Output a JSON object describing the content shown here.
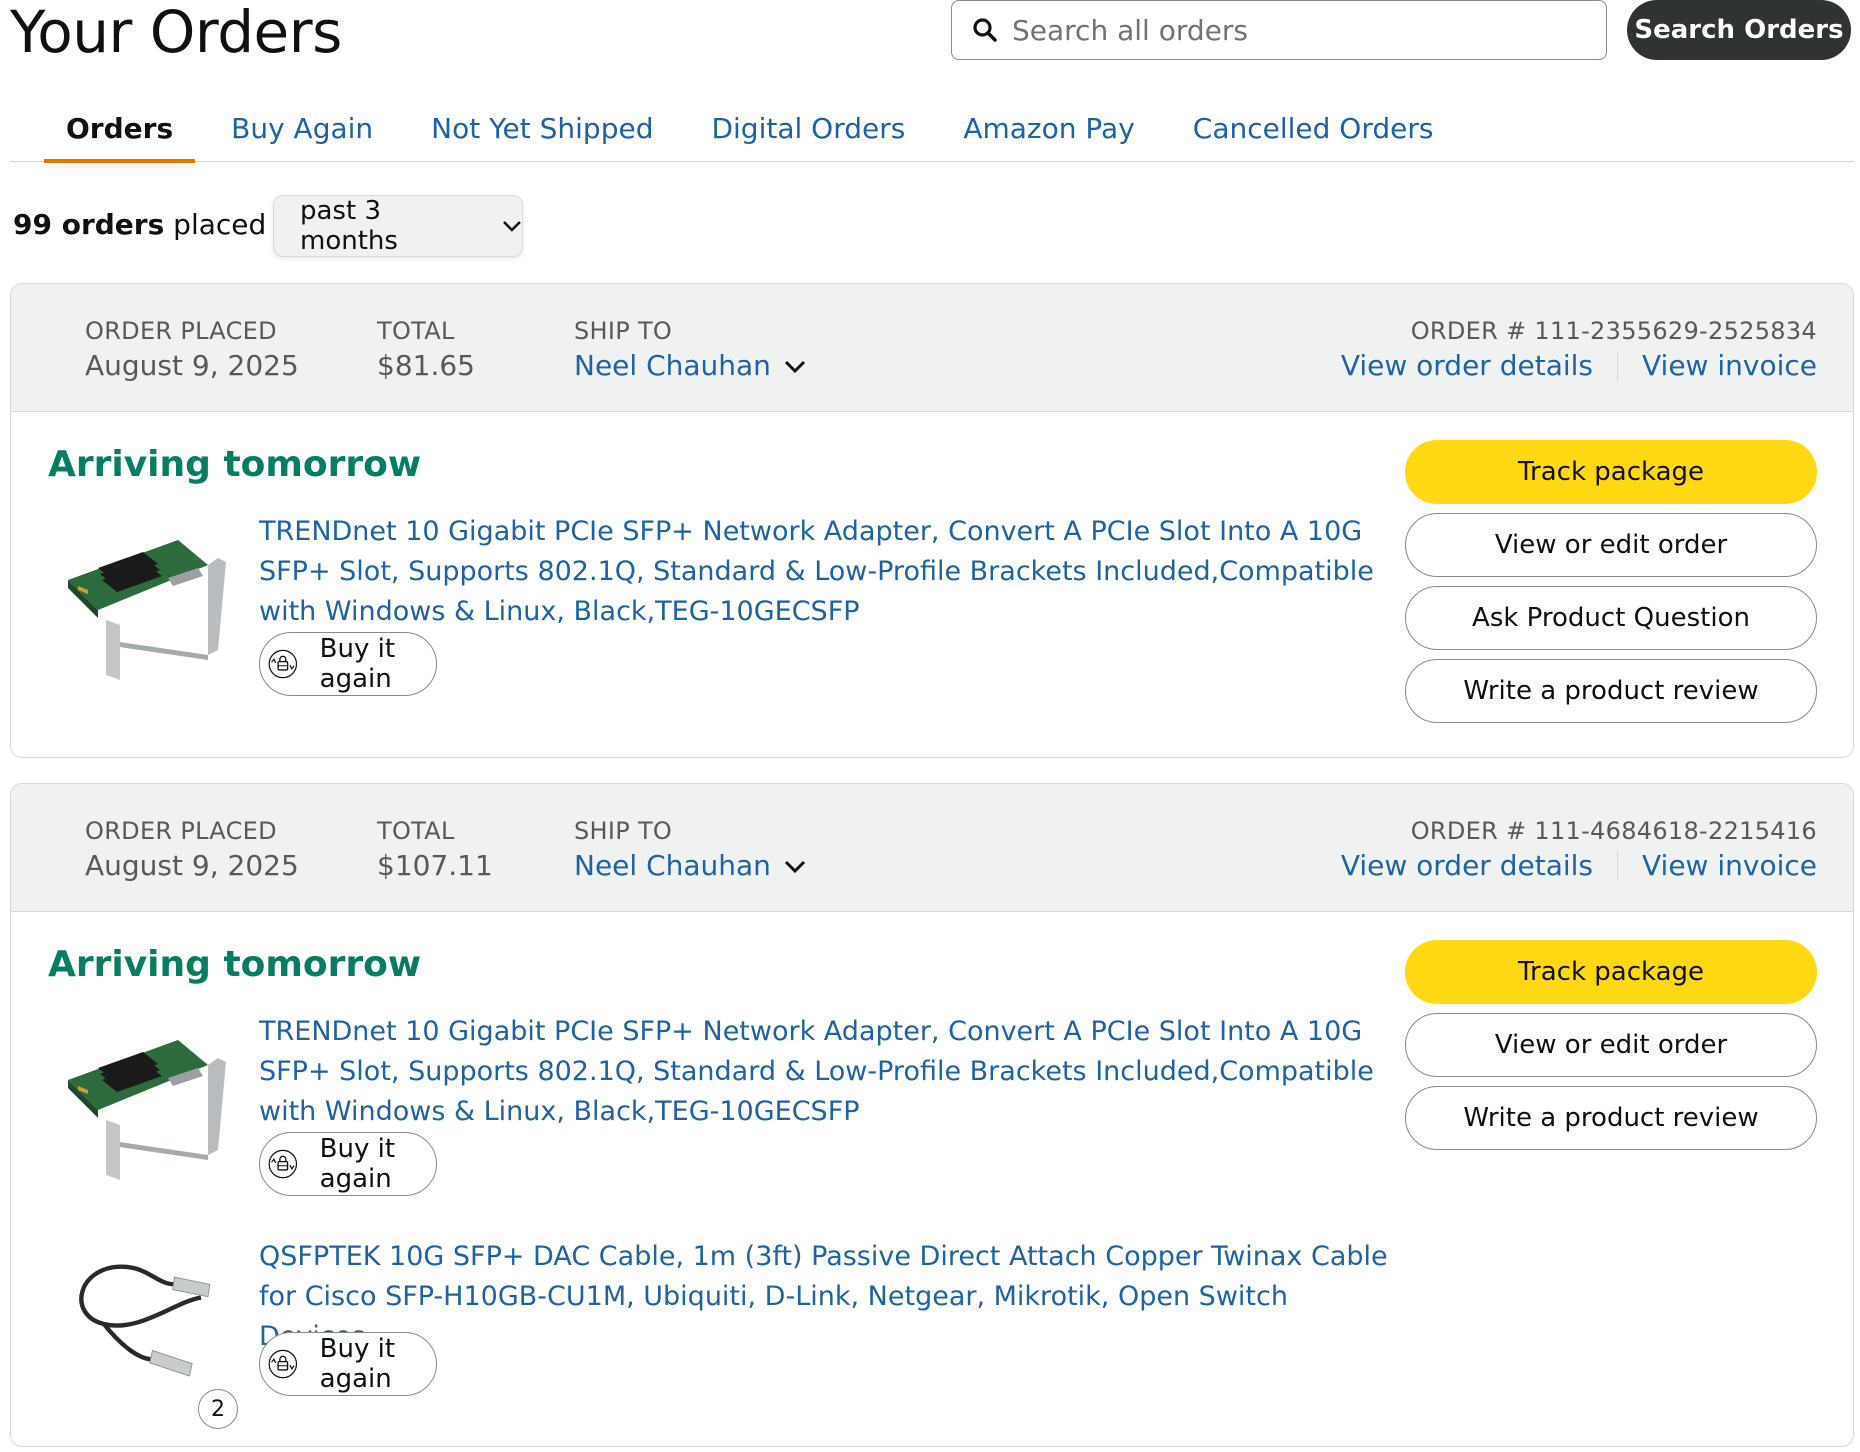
{
  "header": {
    "title": "Your Orders",
    "search_placeholder": "Search all orders",
    "search_button": "Search Orders"
  },
  "tabs": [
    {
      "label": "Orders",
      "active": true
    },
    {
      "label": "Buy Again"
    },
    {
      "label": "Not Yet Shipped"
    },
    {
      "label": "Digital Orders"
    },
    {
      "label": "Amazon Pay"
    },
    {
      "label": "Cancelled Orders"
    }
  ],
  "filter": {
    "count_bold": "99 orders",
    "count_rest": " placed in",
    "period": "past 3 months"
  },
  "labels": {
    "order_placed": "ORDER PLACED",
    "total": "TOTAL",
    "ship_to": "SHIP TO",
    "view_order_details": "View order details",
    "view_invoice": "View invoice",
    "buy_it_again": "Buy it again"
  },
  "orders": [
    {
      "date": "August 9, 2025",
      "total": "$81.65",
      "ship_to": "Neel Chauhan",
      "order_number": "ORDER # 111-2355629-2525834",
      "status": "Arriving tomorrow",
      "items": [
        {
          "title": "TRENDnet 10 Gigabit PCIe SFP+ Network Adapter, Convert A PCIe Slot Into A 10G SFP+ Slot, Supports 802.1Q, Standard & Low-Profile Brackets Included,Compatible with Windows & Linux, Black,TEG-10GECSFP"
        }
      ],
      "actions": [
        "Track package",
        "View or edit order",
        "Ask Product Question",
        "Write a product review"
      ]
    },
    {
      "date": "August 9, 2025",
      "total": "$107.11",
      "ship_to": "Neel Chauhan",
      "order_number": "ORDER # 111-4684618-2215416",
      "status": "Arriving tomorrow",
      "items": [
        {
          "title": "TRENDnet 10 Gigabit PCIe SFP+ Network Adapter, Convert A PCIe Slot Into A 10G SFP+ Slot, Supports 802.1Q, Standard & Low-Profile Brackets Included,Compatible with Windows & Linux, Black,TEG-10GECSFP"
        },
        {
          "title": "QSFPTEK 10G SFP+ DAC Cable, 1m (3ft) Passive Direct Attach Copper Twinax Cable for Cisco SFP-H10GB-CU1M, Ubiquiti, D-Link, Netgear, Mikrotik, Open Switch Devices",
          "quantity": "2"
        }
      ],
      "actions": [
        "Track package",
        "View or edit order",
        "Write a product review"
      ]
    }
  ],
  "colors": {
    "link": "#2162a1",
    "arriving": "#067d62",
    "track_button": "#ffd814",
    "tab_underline": "#e77600",
    "search_button": "#303333"
  }
}
